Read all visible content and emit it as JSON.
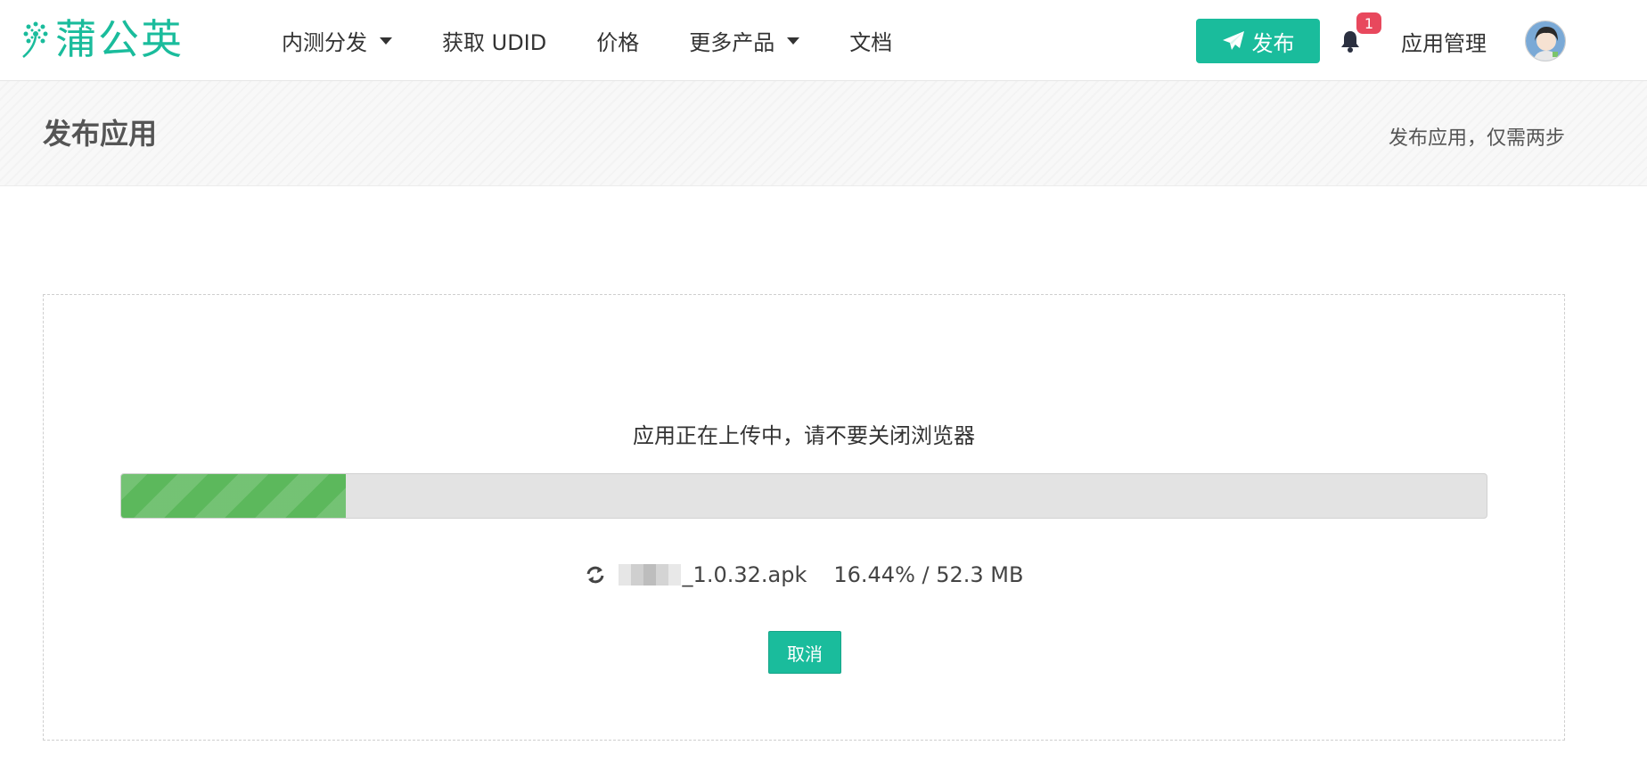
{
  "header": {
    "logo_text": "蒲公英",
    "nav": [
      {
        "label": "内测分发",
        "dropdown": true
      },
      {
        "label": "获取 UDID",
        "dropdown": false
      },
      {
        "label": "价格",
        "dropdown": false
      },
      {
        "label": "更多产品",
        "dropdown": true
      },
      {
        "label": "文档",
        "dropdown": false
      }
    ],
    "publish_label": "发布",
    "notification_count": "1",
    "app_management_label": "应用管理"
  },
  "subheader": {
    "title": "发布应用",
    "subtitle": "发布应用，仅需两步"
  },
  "upload": {
    "message": "应用正在上传中，请不要关闭浏览器",
    "progress_percent": 16.44,
    "file_name_suffix": "_1.0.32.apk",
    "progress_text": "16.44% / 52.3 MB",
    "cancel_label": "取消"
  },
  "colors": {
    "brand": "#1abc9c",
    "progress": "#5cb85c",
    "badge": "#e8485d"
  }
}
